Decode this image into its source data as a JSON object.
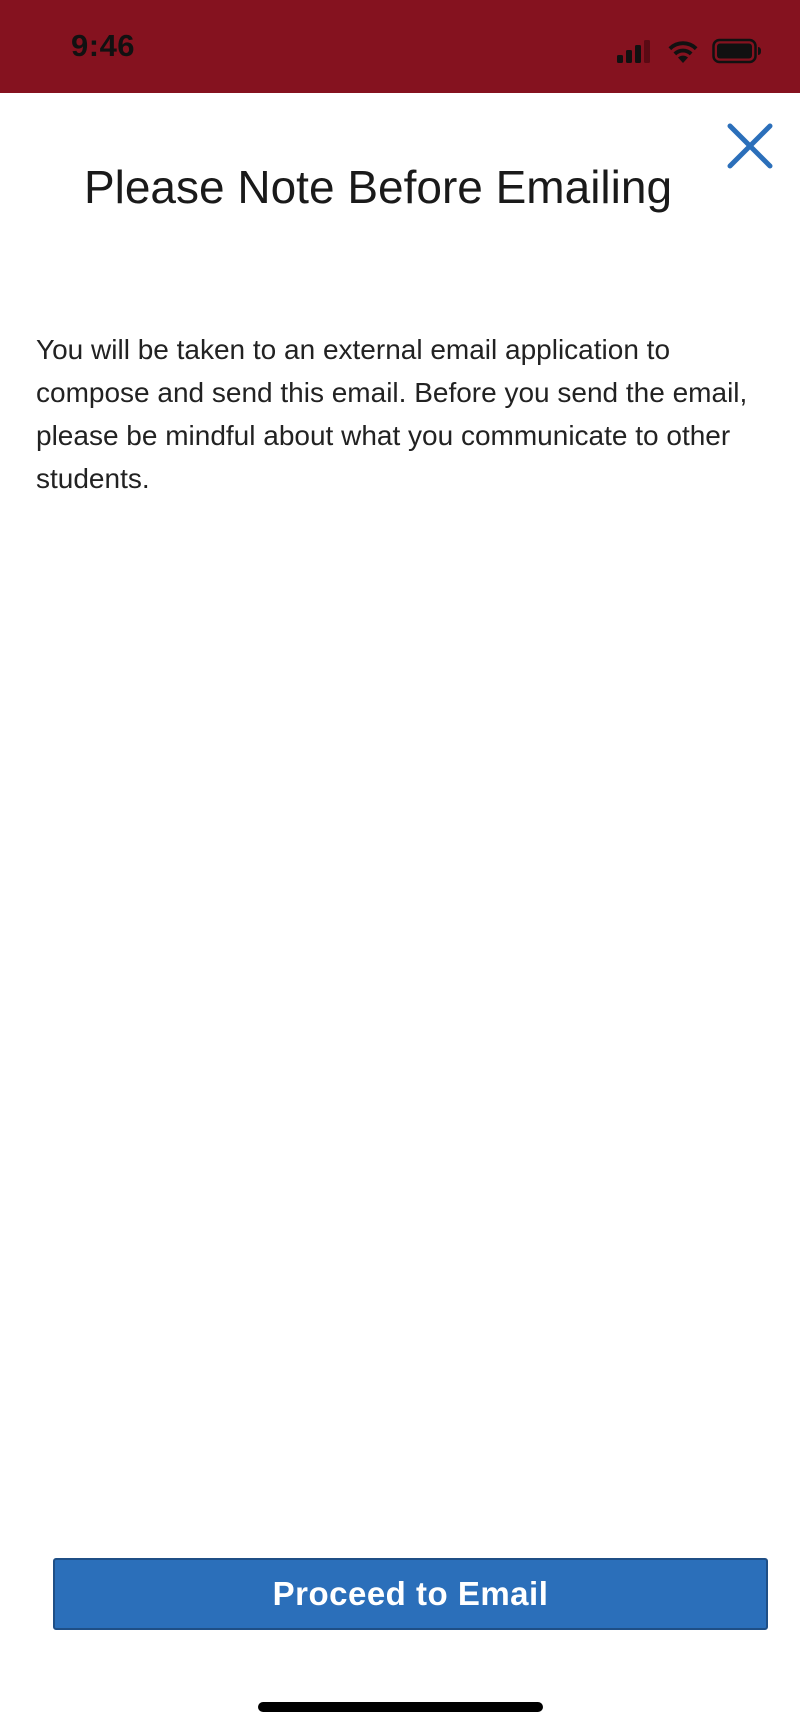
{
  "status_bar": {
    "time": "9:46",
    "background_color": "#85121f",
    "icons": [
      "cellular-signal-icon",
      "wifi-icon",
      "battery-icon"
    ]
  },
  "dialog": {
    "title": "Please Note Before Emailing",
    "message": "You will be taken to an external email application to compose and send this email. Before you send the email, please be mindful about what you communicate to other students.",
    "close_icon": "close-icon",
    "accent_color": "#2b6fba"
  },
  "actions": {
    "proceed_label": "Proceed to Email"
  }
}
